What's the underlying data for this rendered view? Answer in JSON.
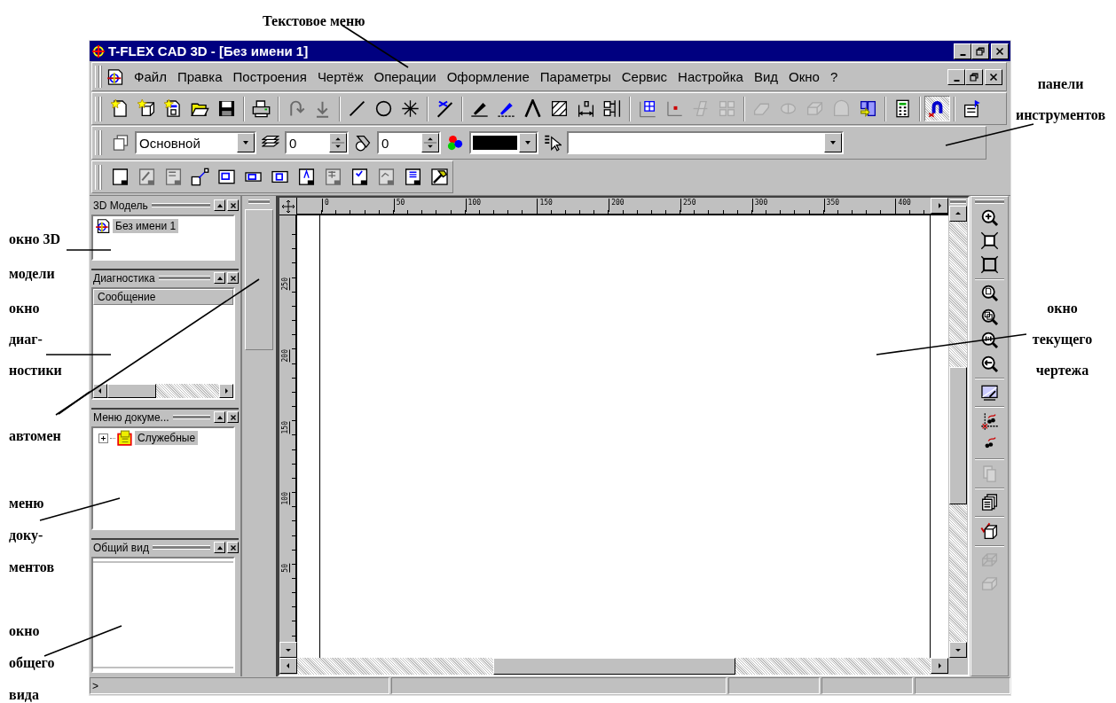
{
  "window": {
    "title": "T-FLEX CAD 3D - [Без имени 1]"
  },
  "menu": [
    "Файл",
    "Правка",
    "Построения",
    "Чертёж",
    "Операции",
    "Оформление",
    "Параметры",
    "Сервис",
    "Настройка",
    "Вид",
    "Окно",
    "?"
  ],
  "main_toolbar": {
    "tools": [
      {
        "kind": "new-page",
        "disabled": false,
        "pressed": false
      },
      {
        "kind": "new-cube",
        "disabled": false,
        "pressed": false
      },
      {
        "kind": "new-template",
        "disabled": false,
        "pressed": false
      },
      {
        "kind": "folder",
        "disabled": false,
        "pressed": false
      },
      {
        "kind": "floppy-disk",
        "disabled": false,
        "pressed": false
      },
      {
        "kind": "separator"
      },
      {
        "kind": "printer",
        "disabled": false,
        "pressed": false
      },
      {
        "kind": "separator"
      },
      {
        "kind": "undo",
        "disabled": true,
        "pressed": false
      },
      {
        "kind": "down-arrow",
        "disabled": true,
        "pressed": false
      },
      {
        "kind": "separator"
      },
      {
        "kind": "line",
        "disabled": false,
        "pressed": false
      },
      {
        "kind": "circle",
        "disabled": false,
        "pressed": false
      },
      {
        "kind": "star-node",
        "disabled": false,
        "pressed": false
      },
      {
        "kind": "separator"
      },
      {
        "kind": "scissors-line",
        "disabled": false,
        "pressed": false
      },
      {
        "kind": "separator"
      },
      {
        "kind": "pen",
        "disabled": false,
        "pressed": false
      },
      {
        "kind": "pen-dashed",
        "disabled": false,
        "pressed": false
      },
      {
        "kind": "chevron",
        "disabled": false,
        "pressed": false
      },
      {
        "kind": "hatch",
        "disabled": false,
        "pressed": false
      },
      {
        "kind": "dimension",
        "disabled": false,
        "pressed": false
      },
      {
        "kind": "align-boxes",
        "disabled": false,
        "pressed": false
      },
      {
        "kind": "separator"
      },
      {
        "kind": "grid",
        "disabled": false,
        "pressed": false
      },
      {
        "kind": "axes",
        "disabled": false,
        "pressed": false
      },
      {
        "kind": "plane",
        "disabled": true,
        "pressed": false
      },
      {
        "kind": "views-grid",
        "disabled": true,
        "pressed": false
      },
      {
        "kind": "separator"
      },
      {
        "kind": "extrude",
        "disabled": true,
        "pressed": false
      },
      {
        "kind": "revolve",
        "disabled": true,
        "pressed": false
      },
      {
        "kind": "box",
        "disabled": true,
        "pressed": false
      },
      {
        "kind": "solid",
        "disabled": true,
        "pressed": false
      },
      {
        "kind": "cubes-arrow",
        "disabled": false,
        "pressed": false
      },
      {
        "kind": "separator"
      },
      {
        "kind": "calculator",
        "disabled": false,
        "pressed": false
      },
      {
        "kind": "separator"
      },
      {
        "kind": "magnet",
        "disabled": false,
        "pressed": true
      },
      {
        "kind": "separator"
      },
      {
        "kind": "properties-card",
        "disabled": false,
        "pressed": false
      }
    ]
  },
  "properties_bar": {
    "layer": "Основной",
    "level": "0",
    "priority": "0"
  },
  "page_toolbar": {
    "tools": [
      {
        "kind": "sheet",
        "disabled": false
      },
      {
        "kind": "sheet-pencil",
        "disabled": true
      },
      {
        "kind": "sheet-lines",
        "disabled": true
      },
      {
        "kind": "link-corner",
        "disabled": false
      },
      {
        "kind": "frame-large",
        "disabled": false
      },
      {
        "kind": "frame-small",
        "disabled": false
      },
      {
        "kind": "frame-right",
        "disabled": false
      },
      {
        "kind": "sheet-mark",
        "disabled": false
      },
      {
        "kind": "sheet-grid",
        "disabled": true
      },
      {
        "kind": "sheet-check",
        "disabled": false
      },
      {
        "kind": "sheet-dim",
        "disabled": true
      },
      {
        "kind": "sheet-list",
        "disabled": false
      },
      {
        "kind": "hammer",
        "disabled": false
      }
    ]
  },
  "panels": [
    {
      "title": "3D Модель",
      "kind": "tree",
      "items": [
        {
          "kind": "model",
          "label": "Без имени 1",
          "selected": true
        }
      ]
    },
    {
      "title": "Диагностика",
      "kind": "table",
      "columns": [
        "Сообщение"
      ]
    },
    {
      "title": "Меню докуме...",
      "kind": "tree",
      "items": [
        {
          "kind": "group",
          "label": "Служебные",
          "selected": true,
          "expanded": false
        }
      ]
    },
    {
      "title": "Общий вид",
      "kind": "overview"
    }
  ],
  "drawing": {
    "ruler_h": [
      "0",
      "50",
      "100",
      "150",
      "200",
      "250",
      "300",
      "350",
      "400"
    ],
    "ruler_v": [
      "250",
      "200",
      "150",
      "100",
      "50"
    ]
  },
  "view_toolbar": {
    "tools": [
      {
        "kind": "zoom-in",
        "disabled": false
      },
      {
        "kind": "fit-frame",
        "disabled": false
      },
      {
        "kind": "fit-window",
        "disabled": false
      },
      {
        "kind": "separator"
      },
      {
        "kind": "zoom-page",
        "disabled": false
      },
      {
        "kind": "zoom-previous",
        "disabled": false
      },
      {
        "kind": "zoom-actual",
        "disabled": false
      },
      {
        "kind": "zoom-out",
        "disabled": false
      },
      {
        "kind": "separator"
      },
      {
        "kind": "screen",
        "disabled": false
      },
      {
        "kind": "separator"
      },
      {
        "kind": "snap-points",
        "disabled": false
      },
      {
        "kind": "snap-curve",
        "disabled": false
      },
      {
        "kind": "separator"
      },
      {
        "kind": "page-copy",
        "disabled": true
      },
      {
        "kind": "separator"
      },
      {
        "kind": "pages",
        "disabled": false
      },
      {
        "kind": "separator"
      },
      {
        "kind": "check-cube",
        "disabled": false
      },
      {
        "kind": "separator"
      },
      {
        "kind": "wire-box",
        "disabled": true
      },
      {
        "kind": "shaded-box",
        "disabled": true
      }
    ]
  },
  "status_bar": {
    "prompt": ">"
  },
  "annotations": [
    {
      "lines": [
        "Текстовое меню"
      ]
    },
    {
      "lines": [
        "панели",
        "инструментов"
      ]
    },
    {
      "lines": [
        "окно 3D",
        "модели"
      ]
    },
    {
      "lines": [
        "окно",
        "диаг-",
        "ностики"
      ]
    },
    {
      "lines": [
        "автомен"
      ]
    },
    {
      "lines": [
        "меню",
        "доку-",
        "ментов"
      ]
    },
    {
      "lines": [
        "окно",
        "общего",
        "вида"
      ]
    },
    {
      "lines": [
        "окно",
        "текущего",
        "чертежа"
      ]
    }
  ]
}
